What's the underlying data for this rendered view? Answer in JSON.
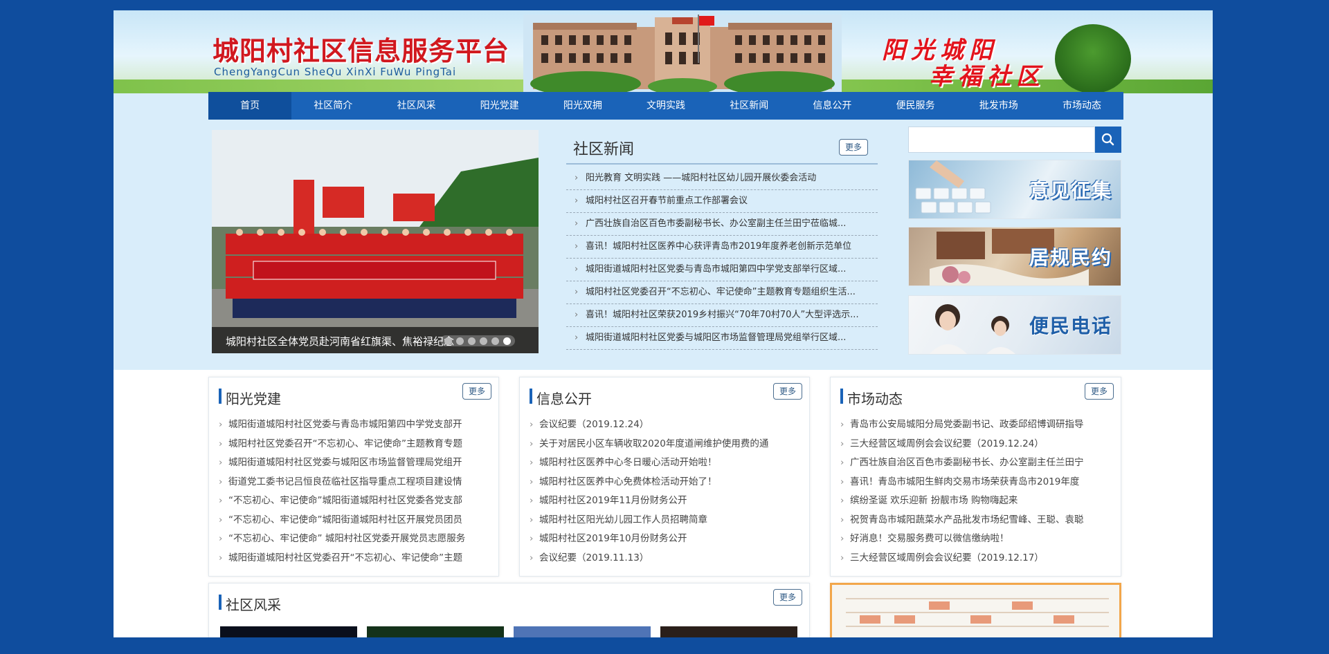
{
  "header": {
    "site_title": "城阳村社区信息服务平台",
    "site_pinyin": "ChengYangCun SheQu XinXi FuWu PingTai",
    "slogan_line1": "阳光城阳",
    "slogan_line2": "幸福社区"
  },
  "nav": {
    "items": [
      "首页",
      "社区简介",
      "社区风采",
      "阳光党建",
      "阳光双拥",
      "文明实践",
      "社区新闻",
      "信息公开",
      "便民服务",
      "批发市场",
      "市场动态"
    ],
    "active_index": 0
  },
  "slideshow": {
    "caption": "城阳村社区全体党员赴河南省红旗渠、焦裕禄纪念馆开展党性教育",
    "dot_count": 6,
    "active_dot": 5
  },
  "community_news": {
    "title": "社区新闻",
    "more_label": "更多",
    "items": [
      "阳光教育 文明实践 ——城阳村社区幼儿园开展伙委会活动",
      "城阳村社区召开春节前重点工作部署会议",
      "广西壮族自治区百色市委副秘书长、办公室副主任兰田宁莅临城...",
      "喜讯！城阳村社区医养中心获评青岛市2019年度养老创新示范单位",
      "城阳街道城阳村社区党委与青岛市城阳第四中学党支部举行区域...",
      "城阳村社区党委召开“不忘初心、牢记使命”主题教育专题组织生活...",
      "喜讯！城阳村社区荣获2019乡村振兴“70年70村70人”大型评选示...",
      "城阳街道城阳村社区党委与城阳区市场监督管理局党组举行区域..."
    ]
  },
  "search": {
    "placeholder": ""
  },
  "banners": {
    "opinion": "意见征集",
    "rules": "居规民约",
    "phone": "便民电话"
  },
  "panels": {
    "party": {
      "title": "阳光党建",
      "more_label": "更多",
      "items": [
        "城阳街道城阳村社区党委与青岛市城阳第四中学党支部开",
        "城阳村社区党委召开“不忘初心、牢记使命”主题教育专题",
        "城阳街道城阳村社区党委与城阳区市场监督管理局党组开",
        "街道党工委书记吕恒良莅临社区指导重点工程项目建设情",
        "“不忘初心、牢记使命”城阳街道城阳村社区党委各党支部",
        "“不忘初心、牢记使命”城阳街道城阳村社区开展党员团员",
        "“不忘初心、牢记使命” 城阳村社区党委开展党员志愿服务",
        "城阳街道城阳村社区党委召开“不忘初心、牢记使命”主题"
      ]
    },
    "info": {
      "title": "信息公开",
      "more_label": "更多",
      "items": [
        "会议纪要（2019.12.24）",
        "关于对居民小区车辆收取2020年度道闸维护使用费的通",
        "城阳村社区医养中心冬日暖心活动开始啦！",
        "城阳村社区医养中心免费体检活动开始了！",
        "城阳村社区2019年11月份财务公开",
        "城阳村社区阳光幼儿园工作人员招聘简章",
        "城阳村社区2019年10月份财务公开",
        "会议纪要（2019.11.13）"
      ]
    },
    "market": {
      "title": "市场动态",
      "more_label": "更多",
      "items": [
        "青岛市公安局城阳分局党委副书记、政委邱绍博调研指导",
        "三大经营区域周例会会议纪要（2019.12.24）",
        "广西壮族自治区百色市委副秘书长、办公室副主任兰田宁",
        "喜讯！青岛市城阳生鲜肉交易市场荣获青岛市2019年度",
        "缤纷圣诞 欢乐迎新 扮靓市场 购物嗨起来",
        "祝贺青岛市城阳蔬菜水产品批发市场纪雪峰、王聪、袁聪",
        "好消息！交易服务费可以微信缴纳啦！",
        "三大经营区域周例会会议纪要（2019.12.17）"
      ]
    },
    "style": {
      "title": "社区风采",
      "more_label": "更多"
    }
  },
  "colors": {
    "background": "#0f4d9e",
    "nav": "#1a63b8",
    "title_red": "#d1181f"
  }
}
